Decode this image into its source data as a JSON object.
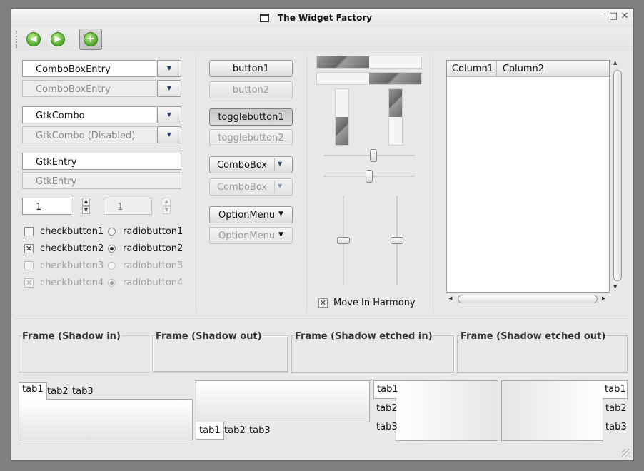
{
  "window": {
    "title": "The Widget Factory",
    "minimize": "–",
    "maximize": "□",
    "close": "✕"
  },
  "toolbar": {
    "back_glyph": "◀",
    "forward_glyph": "▶",
    "add_glyph": "+"
  },
  "combos": {
    "comboboxentry": "ComboBoxEntry",
    "comboboxentry_disabled": "ComboBoxEntry",
    "gtkcombo": "GtkCombo",
    "gtkcombo_disabled": "GtkCombo (Disabled)",
    "arrow_glyph": "▼"
  },
  "entries": {
    "gtkentry": "GtkEntry",
    "gtkentry_disabled": "GtkEntry"
  },
  "spins": {
    "value": "1",
    "value_disabled": "1",
    "up": "▲",
    "down": "▼"
  },
  "checks": {
    "checkbutton1": "checkbutton1",
    "checkbutton2": "checkbutton2",
    "checkbutton3": "checkbutton3",
    "checkbutton4": "checkbutton4",
    "mark": "✕"
  },
  "radios": {
    "radiobutton1": "radiobutton1",
    "radiobutton2": "radiobutton2",
    "radiobutton3": "radiobutton3",
    "radiobutton4": "radiobutton4"
  },
  "buttons": {
    "button1": "button1",
    "button2": "button2",
    "togglebutton1": "togglebutton1",
    "togglebutton2": "togglebutton2",
    "combobox": "ComboBox",
    "combobox_disabled": "ComboBox",
    "optionmenu": "OptionMenu",
    "optionmenu_disabled": "OptionMenu"
  },
  "progress": {
    "horizontal_1": 0.5,
    "horizontal_2": 0.5,
    "vertical_1": 0.5,
    "vertical_2": 0.5
  },
  "sliders": {
    "h1": 0.55,
    "h2": 0.5,
    "v1": 0.5,
    "v2": 0.5
  },
  "harmony": {
    "label": "Move In Harmony",
    "checked": true
  },
  "tree": {
    "columns": [
      "Column1",
      "Column2"
    ]
  },
  "frames": [
    {
      "label": "Frame (Shadow in)"
    },
    {
      "label": "Frame (Shadow out)"
    },
    {
      "label": "Frame (Shadow etched in)"
    },
    {
      "label": "Frame (Shadow etched out)"
    }
  ],
  "notebooks": {
    "tabs": [
      "tab1",
      "tab2",
      "tab3"
    ]
  }
}
